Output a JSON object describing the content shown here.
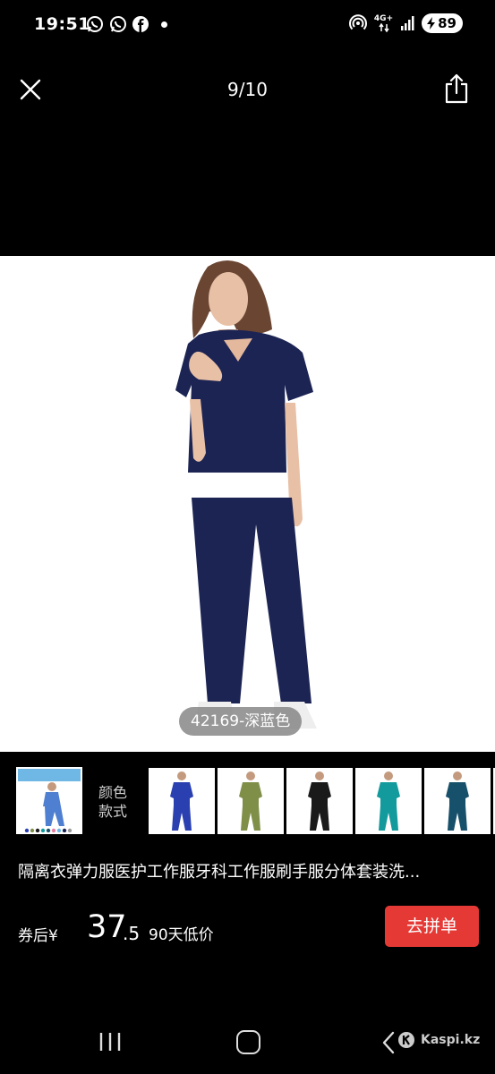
{
  "status_bar": {
    "time": "19:51",
    "network": "4G+",
    "battery": "89",
    "app_icons": [
      "whatsapp-icon",
      "whatsapp-icon",
      "facebook-icon",
      "notification-dot-icon"
    ]
  },
  "viewer": {
    "counter": "9/10",
    "close_icon": "close-icon",
    "share_icon": "share-icon"
  },
  "image": {
    "caption": "42169-深蓝色",
    "uniform_color": "#1c2453"
  },
  "variants": {
    "label_line1": "颜色",
    "label_line2": "款式",
    "swatches": [
      {
        "name": "royal-blue",
        "color": "#2a3fb0"
      },
      {
        "name": "olive-green",
        "color": "#7f8f48"
      },
      {
        "name": "black",
        "color": "#1a1a1a"
      },
      {
        "name": "teal",
        "color": "#139a9c"
      },
      {
        "name": "dark-teal",
        "color": "#17506a"
      }
    ]
  },
  "product": {
    "title": "隔离衣弹力服医护工作服牙科工作服刷手服分体套装洗..."
  },
  "price": {
    "prefix": "券后¥",
    "integer": "37",
    "decimal": ".5",
    "note": "90天低价",
    "button": "去拼单",
    "button_color": "#e53935"
  },
  "watermark": {
    "text": "Kaspi.kz"
  }
}
